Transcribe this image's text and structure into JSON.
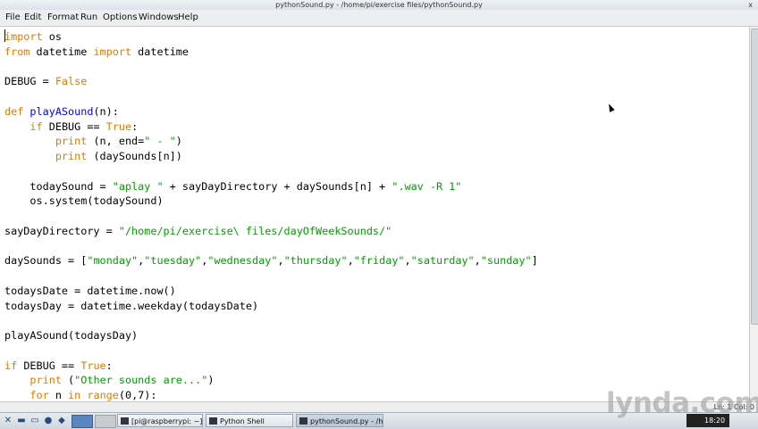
{
  "window": {
    "title": "pythonSound.py - /home/pi/exercise files/pythonSound.py",
    "close_glyph": "x"
  },
  "menubar": {
    "items": [
      "File",
      "Edit",
      "Format",
      "Run",
      "Options",
      "Windows",
      "Help"
    ]
  },
  "editor": {
    "colors": {
      "keyword": "#e07b00",
      "string": "#00a000",
      "defname": "#0000ff",
      "text": "#000000"
    },
    "lines": [
      [
        [
          "kw",
          "import"
        ],
        [
          "t",
          " os"
        ]
      ],
      [
        [
          "kw",
          "from"
        ],
        [
          "t",
          " datetime "
        ],
        [
          "kw",
          "import"
        ],
        [
          "t",
          " datetime"
        ]
      ],
      [],
      [
        [
          "t",
          "DEBUG = "
        ],
        [
          "kw",
          "False"
        ]
      ],
      [],
      [
        [
          "kw",
          "def"
        ],
        [
          "t",
          " "
        ],
        [
          "df",
          "playASound"
        ],
        [
          "t",
          "(n):"
        ]
      ],
      [
        [
          "t",
          "    "
        ],
        [
          "kw",
          "if"
        ],
        [
          "t",
          " DEBUG == "
        ],
        [
          "kw",
          "True"
        ],
        [
          "t",
          ":"
        ]
      ],
      [
        [
          "t",
          "        "
        ],
        [
          "kw",
          "print"
        ],
        [
          "t",
          " (n, end="
        ],
        [
          "st",
          "\" - \""
        ],
        [
          "t",
          ")"
        ]
      ],
      [
        [
          "t",
          "        "
        ],
        [
          "kw",
          "print"
        ],
        [
          "t",
          " (daySounds[n])"
        ]
      ],
      [],
      [
        [
          "t",
          "    todaySound = "
        ],
        [
          "st",
          "\"aplay \""
        ],
        [
          "t",
          " + sayDayDirectory + daySounds[n] + "
        ],
        [
          "st",
          "\".wav -R 1\""
        ]
      ],
      [
        [
          "t",
          "    os.system(todaySound)"
        ]
      ],
      [],
      [
        [
          "t",
          "sayDayDirectory = "
        ],
        [
          "st",
          "\"/home/pi/exercise\\ files/dayOfWeekSounds/\""
        ]
      ],
      [],
      [
        [
          "t",
          "daySounds = ["
        ],
        [
          "st",
          "\"monday\""
        ],
        [
          "t",
          ","
        ],
        [
          "st",
          "\"tuesday\""
        ],
        [
          "t",
          ","
        ],
        [
          "st",
          "\"wednesday\""
        ],
        [
          "t",
          ","
        ],
        [
          "st",
          "\"thursday\""
        ],
        [
          "t",
          ","
        ],
        [
          "st",
          "\"friday\""
        ],
        [
          "t",
          ","
        ],
        [
          "st",
          "\"saturday\""
        ],
        [
          "t",
          ","
        ],
        [
          "st",
          "\"sunday\""
        ],
        [
          "t",
          "]"
        ]
      ],
      [],
      [
        [
          "t",
          "todaysDate = datetime.now()"
        ]
      ],
      [
        [
          "t",
          "todaysDay = datetime.weekday(todaysDate)"
        ]
      ],
      [],
      [
        [
          "t",
          "playASound(todaysDay)"
        ]
      ],
      [],
      [
        [
          "kw",
          "if"
        ],
        [
          "t",
          " DEBUG == "
        ],
        [
          "kw",
          "True"
        ],
        [
          "t",
          ":"
        ]
      ],
      [
        [
          "t",
          "    "
        ],
        [
          "kw",
          "print"
        ],
        [
          "t",
          " ("
        ],
        [
          "st",
          "\"Other sounds are...\""
        ],
        [
          "t",
          ")"
        ]
      ],
      [
        [
          "t",
          "    "
        ],
        [
          "kw",
          "for"
        ],
        [
          "t",
          " n "
        ],
        [
          "kw",
          "in"
        ],
        [
          "t",
          " "
        ],
        [
          "kw",
          "range"
        ],
        [
          "t",
          "(0,7):"
        ]
      ]
    ]
  },
  "statusbar": {
    "position": "Ln: 1 Col: 0"
  },
  "taskbar": {
    "items": [
      {
        "label": "[pi@raspberrypi: ~]",
        "active": false
      },
      {
        "label": "Python Shell",
        "active": false
      },
      {
        "label": "pythonSound.py - /hom...",
        "active": true
      }
    ],
    "clock": "18:20"
  },
  "watermark": "lynda.com"
}
